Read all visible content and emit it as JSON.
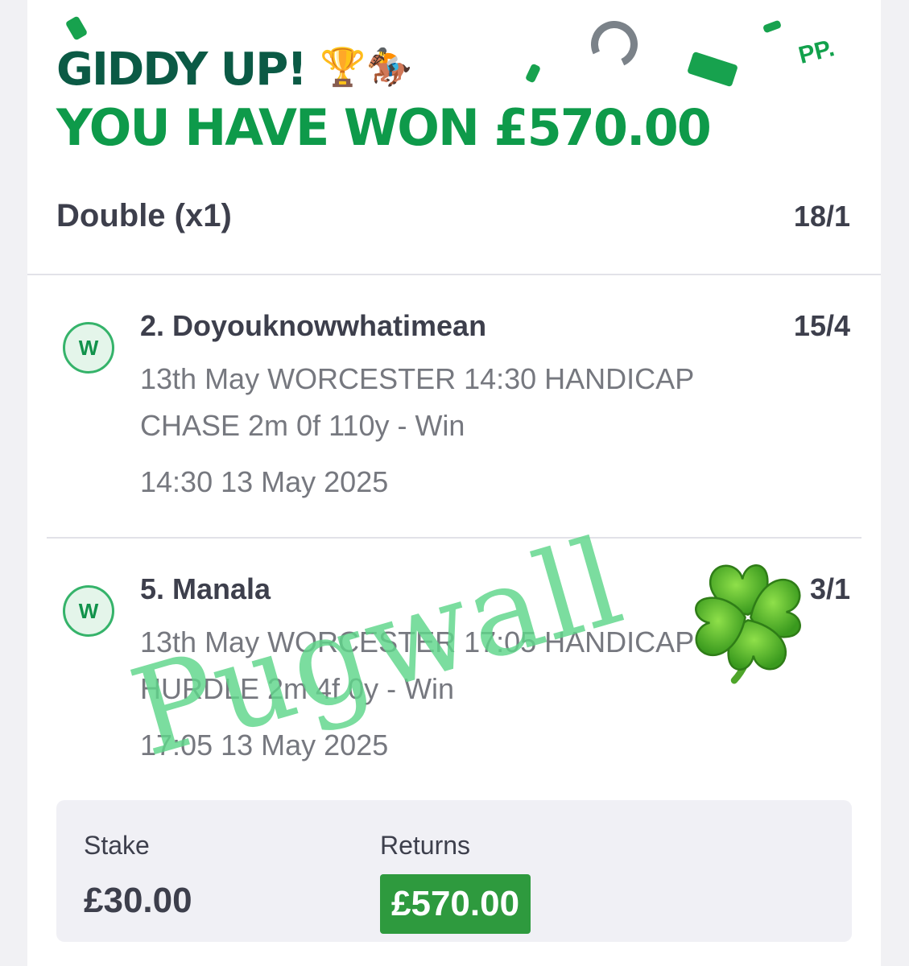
{
  "header": {
    "line1": "GIDDY UP!",
    "line2": "YOU HAVE WON £570.00",
    "trophy_emoji": "🏆",
    "horse_emoji": "🏇",
    "corner_mark": "PP."
  },
  "bet": {
    "type": "Double (x1)",
    "odds": "18/1"
  },
  "legs": [
    {
      "status": "W",
      "name": "2. Doyouknowwhatimean",
      "odds": "15/4",
      "description": "13th May WORCESTER 14:30 HANDICAP CHASE 2m 0f 110y - Win",
      "time": "14:30 13 May 2025"
    },
    {
      "status": "W",
      "name": "5. Manala",
      "odds": "3/1",
      "description": "13th May WORCESTER 17:05 HANDICAP HURDLE 2m 4f 0y - Win",
      "time": "17:05 13 May 2025"
    }
  ],
  "summary": {
    "stake_label": "Stake",
    "stake_value": "£30.00",
    "returns_label": "Returns",
    "returns_value": "£570.00"
  },
  "watermark": {
    "text": "Pugwall",
    "icon": "four-leaf-clover-icon"
  },
  "colors": {
    "headline_dark": "#0b5a45",
    "headline_green": "#0e9a4a",
    "win_badge": "#35b36a",
    "returns_bg": "#2e9a3e",
    "watermark": "#5fd68a"
  }
}
